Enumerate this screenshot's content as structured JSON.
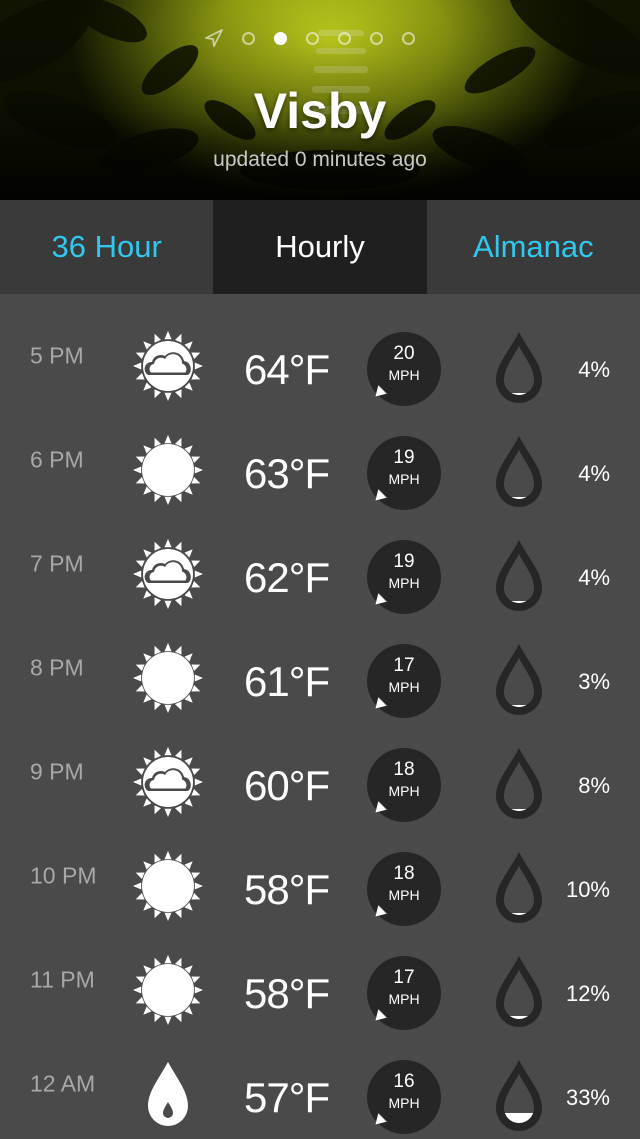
{
  "header": {
    "city": "Visby",
    "updated": "updated 0 minutes ago",
    "page_count": 6,
    "active_page": 0
  },
  "tabs": [
    {
      "label": "36 Hour",
      "active": false
    },
    {
      "label": "Hourly",
      "active": true
    },
    {
      "label": "Almanac",
      "active": false
    }
  ],
  "colors": {
    "accent": "#31c8ef",
    "background": "#4a4a4a",
    "active_tab": "#1f1f1f",
    "inactive_tab": "#3a3a3a",
    "wind_badge": "#262626"
  },
  "hourly": [
    {
      "time": "5 PM",
      "icon": "partly-cloudy-icon",
      "temp": "64°F",
      "wind_speed": "20",
      "wind_unit": "MPH",
      "precip": "4%",
      "precip_fraction": 0.04
    },
    {
      "time": "6 PM",
      "icon": "sunny-icon",
      "temp": "63°F",
      "wind_speed": "19",
      "wind_unit": "MPH",
      "precip": "4%",
      "precip_fraction": 0.04
    },
    {
      "time": "7 PM",
      "icon": "partly-cloudy-icon",
      "temp": "62°F",
      "wind_speed": "19",
      "wind_unit": "MPH",
      "precip": "4%",
      "precip_fraction": 0.04
    },
    {
      "time": "8 PM",
      "icon": "sunny-icon",
      "temp": "61°F",
      "wind_speed": "17",
      "wind_unit": "MPH",
      "precip": "3%",
      "precip_fraction": 0.03
    },
    {
      "time": "9 PM",
      "icon": "partly-cloudy-icon",
      "temp": "60°F",
      "wind_speed": "18",
      "wind_unit": "MPH",
      "precip": "8%",
      "precip_fraction": 0.08
    },
    {
      "time": "10 PM",
      "icon": "sunny-icon",
      "temp": "58°F",
      "wind_speed": "18",
      "wind_unit": "MPH",
      "precip": "10%",
      "precip_fraction": 0.1
    },
    {
      "time": "11 PM",
      "icon": "sunny-icon",
      "temp": "58°F",
      "wind_speed": "17",
      "wind_unit": "MPH",
      "precip": "12%",
      "precip_fraction": 0.12
    },
    {
      "time": "12 AM",
      "icon": "rain-drop-icon",
      "temp": "57°F",
      "wind_speed": "16",
      "wind_unit": "MPH",
      "precip": "33%",
      "precip_fraction": 0.33
    }
  ]
}
